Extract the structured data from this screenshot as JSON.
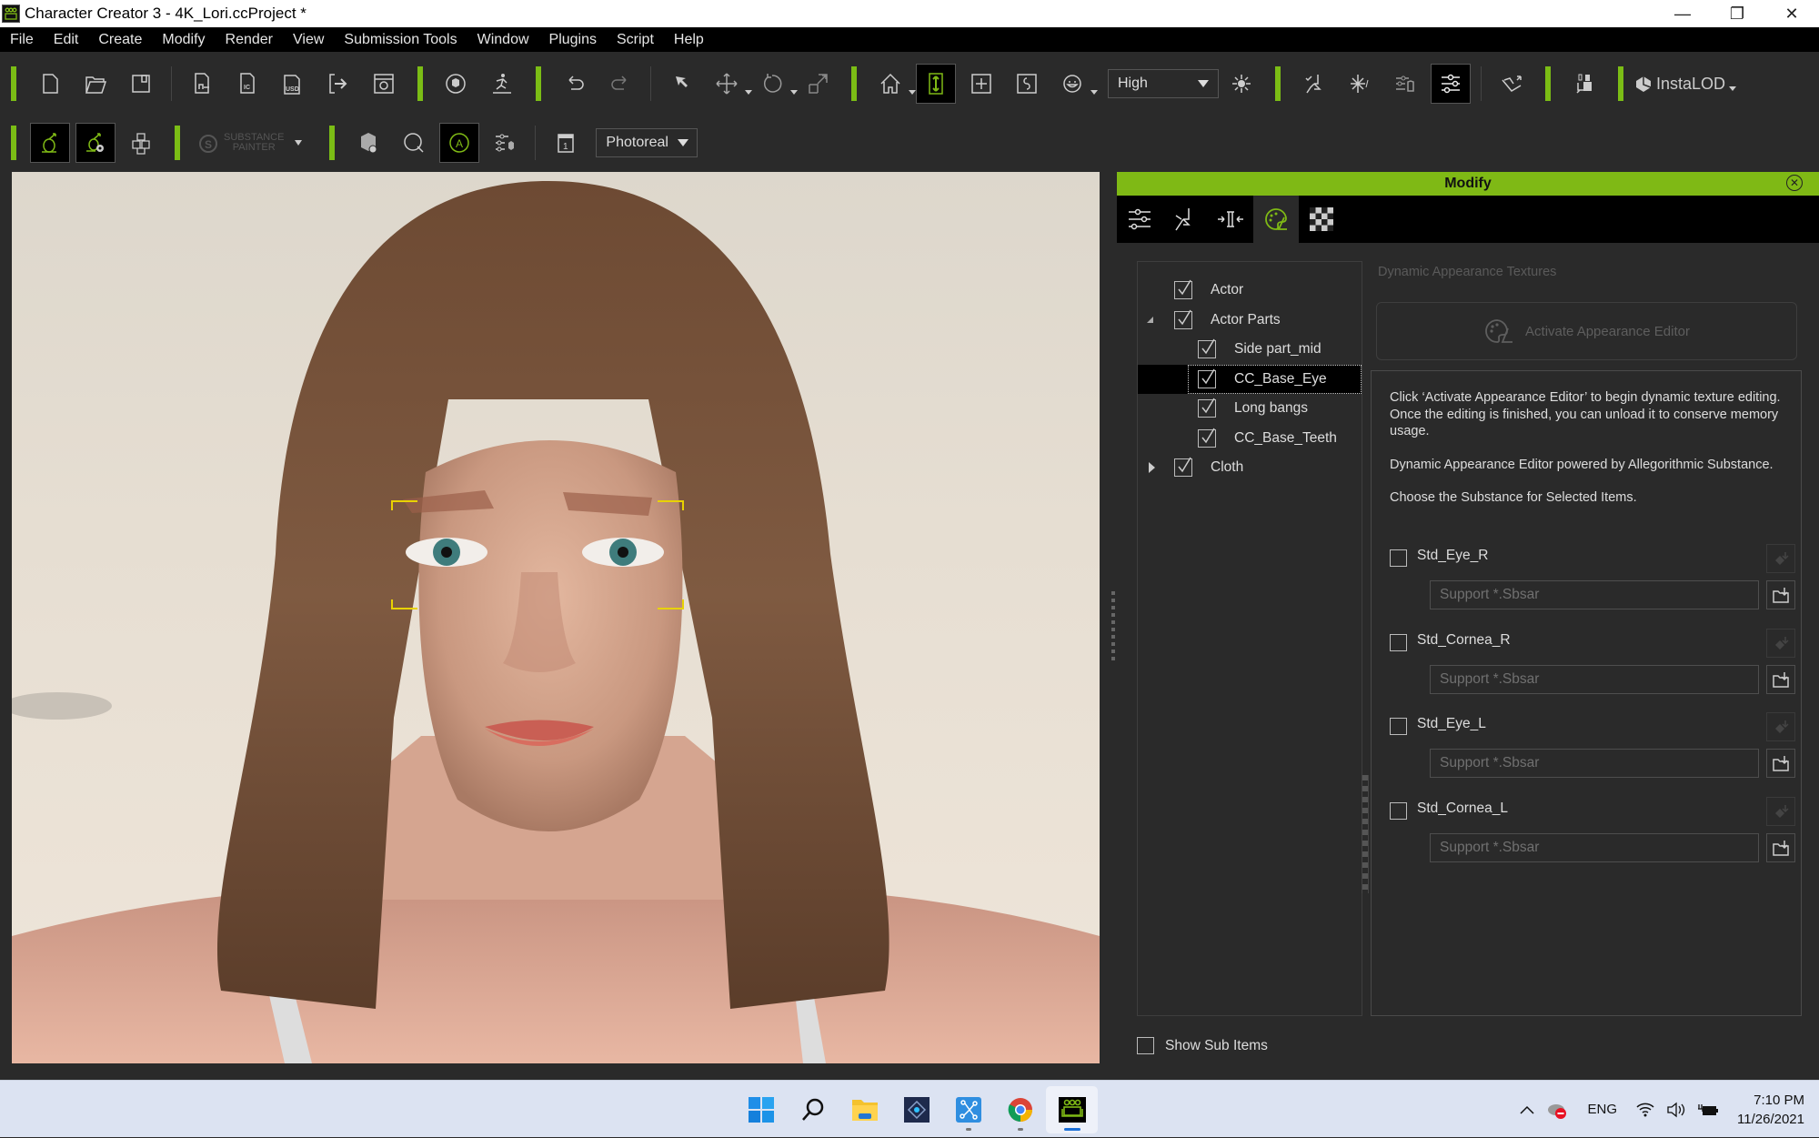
{
  "window": {
    "title": "Character Creator 3 - 4K_Lori.ccProject *",
    "controls": {
      "minimize": "—",
      "maximize": "❐",
      "close": "✕"
    }
  },
  "menubar": [
    "File",
    "Edit",
    "Create",
    "Modify",
    "Render",
    "View",
    "Submission Tools",
    "Window",
    "Plugins",
    "Script",
    "Help"
  ],
  "toolbar": {
    "quality_select": "High",
    "render_select": "Photoreal",
    "substance_painter_label_1": "SUBSTANCE",
    "substance_painter_label_2": "PAINTER",
    "instalod_label": "InstaLOD"
  },
  "accent_color": "#7fb915",
  "modify_panel": {
    "title": "Modify",
    "active_tab": "appearance-editor",
    "tree": [
      {
        "label": "Actor",
        "checked": true,
        "level": 0
      },
      {
        "label": "Actor Parts",
        "checked": true,
        "level": 0,
        "expanded": true
      },
      {
        "label": "Side part_mid",
        "checked": true,
        "level": 1
      },
      {
        "label": "CC_Base_Eye",
        "checked": true,
        "level": 1,
        "selected": true
      },
      {
        "label": "Long bangs",
        "checked": true,
        "level": 1
      },
      {
        "label": "CC_Base_Teeth",
        "checked": true,
        "level": 1
      },
      {
        "label": "Cloth",
        "checked": true,
        "level": 0,
        "expanded": false
      }
    ],
    "section_title": "Dynamic Appearance Textures",
    "activate_button": "Activate Appearance Editor",
    "info": [
      "Click ‘Activate Appearance Editor’ to begin dynamic texture editing. Once the editing is finished, you can unload it to conserve memory usage.",
      "Dynamic Appearance Editor powered by Allegorithmic Substance.",
      "Choose the Substance for Selected Items."
    ],
    "substances": [
      {
        "name": "Std_Eye_R",
        "checked": false,
        "placeholder": "Support *.Sbsar"
      },
      {
        "name": "Std_Cornea_R",
        "checked": false,
        "placeholder": "Support *.Sbsar"
      },
      {
        "name": "Std_Eye_L",
        "checked": false,
        "placeholder": "Support *.Sbsar"
      },
      {
        "name": "Std_Cornea_L",
        "checked": false,
        "placeholder": "Support *.Sbsar"
      }
    ],
    "show_sub_items": {
      "label": "Show Sub Items",
      "checked": false
    }
  },
  "taskbar": {
    "apps": [
      "windows-start",
      "search",
      "file-explorer",
      "photoshop-elements",
      "network-app",
      "chrome",
      "character-creator"
    ],
    "tray": {
      "language": "ENG",
      "time": "7:10 PM",
      "date": "11/26/2021"
    }
  }
}
